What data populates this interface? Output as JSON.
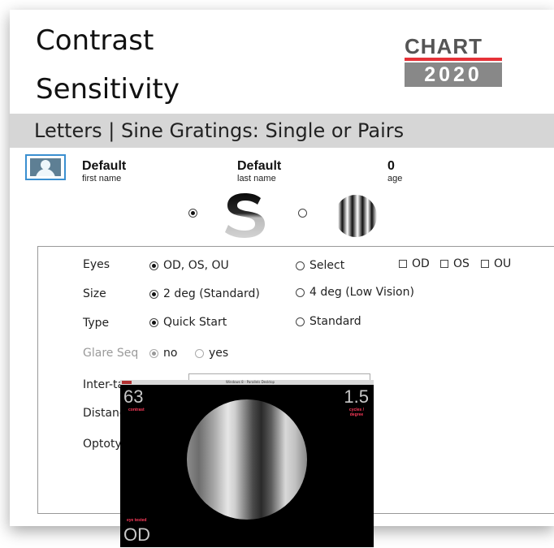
{
  "header": {
    "title_line1": "Contrast",
    "title_line2": "Sensitivity",
    "logo_top": "CHART",
    "logo_bottom": "2020",
    "subtitle": "Letters | Sine Gratings: Single or Pairs"
  },
  "patient": {
    "first_name_value": "Default",
    "first_name_label": "first name",
    "last_name_value": "Default",
    "last_name_label": "last name",
    "age_value": "0",
    "age_label": "age"
  },
  "mode": {
    "letters_selected": true,
    "gratings_selected": false,
    "letter_glyph": "S"
  },
  "settings": {
    "eyes": {
      "label": "Eyes",
      "opt1": "OD, OS, OU",
      "opt2": "Select",
      "chk1": "OD",
      "chk2": "OS",
      "chk3": "OU"
    },
    "size": {
      "label": "Size",
      "opt1": "2 deg (Standard)",
      "opt2": "4 deg (Low Vision)"
    },
    "type": {
      "label": "Type",
      "opt1": "Quick Start",
      "opt2": "Standard"
    },
    "glare": {
      "label": "Glare Seq",
      "opt1": "no",
      "opt2": "yes"
    },
    "inter": {
      "label": "Inter-ta"
    },
    "distance": {
      "label": "Distanc"
    },
    "optotype": {
      "label": "Optotyp"
    }
  },
  "preview": {
    "window_title": "Windows 8 - Parallels Desktop",
    "contrast_value": "63",
    "contrast_label": "contrast",
    "cpd_value": "1.5",
    "cpd_label_1": "cycles /",
    "cpd_label_2": "degree",
    "eye_label": "eye tested",
    "eye_value": "OD"
  },
  "colors": {
    "subtitle_band": "#d6d6d6",
    "logo_red": "#e53238",
    "logo_gray": "#888888",
    "accent_blue": "#3a8fd0",
    "overlay_red": "#ff3b5b"
  }
}
